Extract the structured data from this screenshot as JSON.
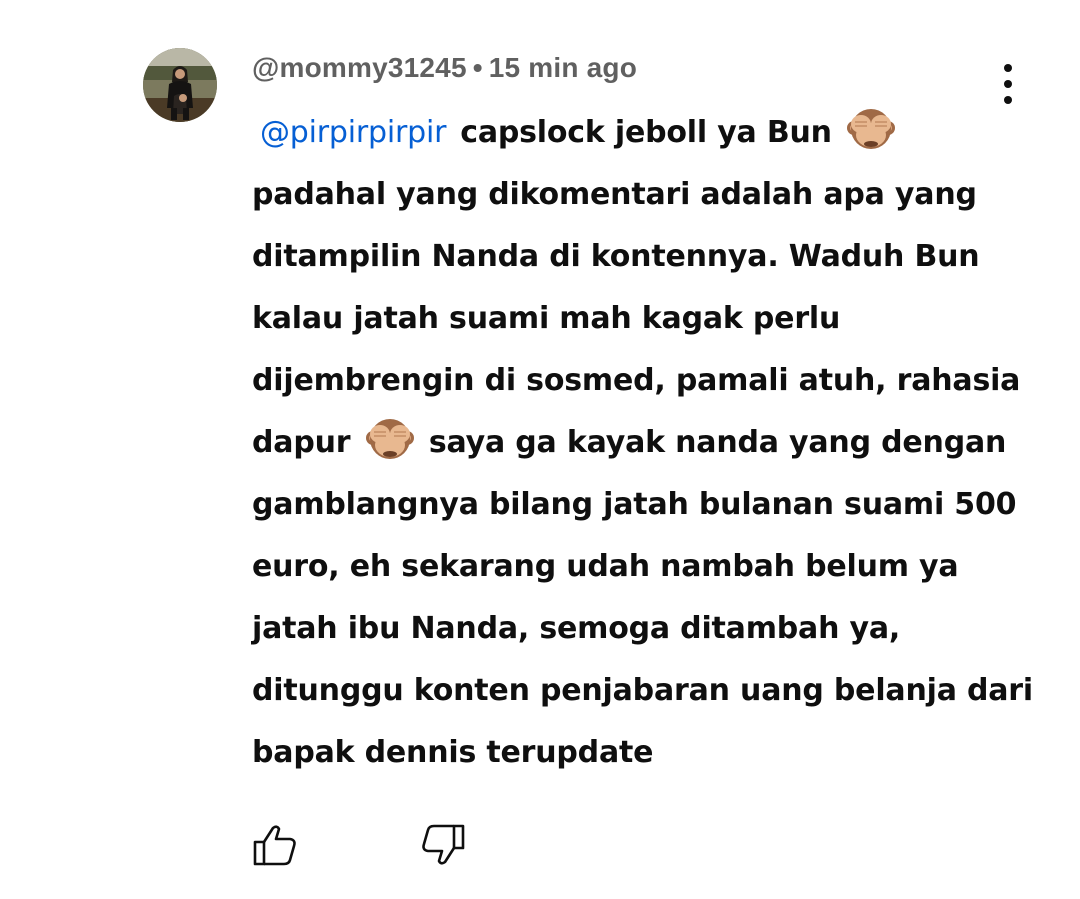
{
  "comment": {
    "author": "@mommy31245",
    "separator": "•",
    "time": "15 min ago",
    "mention": "@pirpirpirpir",
    "lines": [
      "capslock jeboll ya Bun",
      "padahal yang dikomentari adalah apa yang",
      "ditampilin Nanda di kontennya. Waduh Bun",
      "kalau jatah suami mah kagak perlu",
      "dijembrengin di sosmed, pamali atuh, rahasia",
      "dapur",
      "saya ga kayak nanda yang dengan",
      "gamblangnya bilang jatah bulanan suami 500",
      "euro, eh sekarang udah nambah belum ya",
      "jatah ibu Nanda, semoga ditambah ya,",
      "ditunggu konten penjabaran uang belanja dari",
      "bapak dennis terupdate"
    ],
    "emoji": "see-no-evil-monkey-icon"
  },
  "actions": {
    "like_icon": "thumbs-up-icon",
    "dislike_icon": "thumbs-down-icon",
    "more_icon": "more-vertical-icon"
  },
  "colors": {
    "mention": "#065fd4",
    "meta": "#606060",
    "text": "#0f0f0f"
  }
}
